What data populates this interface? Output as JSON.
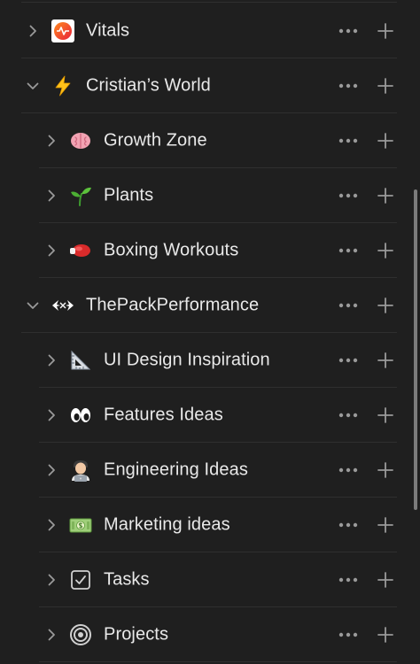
{
  "sidebar": {
    "items": [
      {
        "label": "Vitals",
        "icon": "vitals-logo-icon",
        "expanded": false,
        "depth": 0
      },
      {
        "label": "Cristian’s World",
        "icon": "lightning-icon",
        "expanded": true,
        "depth": 0
      },
      {
        "label": "Growth Zone",
        "icon": "brain-icon",
        "expanded": false,
        "depth": 1
      },
      {
        "label": "Plants",
        "icon": "seedling-icon",
        "expanded": false,
        "depth": 1
      },
      {
        "label": "Boxing Workouts",
        "icon": "boxing-glove-icon",
        "expanded": false,
        "depth": 1
      },
      {
        "label": "ThePackPerformance",
        "icon": "pack-logo-icon",
        "expanded": true,
        "depth": 0
      },
      {
        "label": "UI Design Inspiration",
        "icon": "triangular-ruler-icon",
        "expanded": false,
        "depth": 1
      },
      {
        "label": "Features Ideas",
        "icon": "eyes-icon",
        "expanded": false,
        "depth": 1
      },
      {
        "label": "Engineering Ideas",
        "icon": "technologist-icon",
        "expanded": false,
        "depth": 1
      },
      {
        "label": "Marketing ideas",
        "icon": "dollar-banknote-icon",
        "expanded": false,
        "depth": 1
      },
      {
        "label": "Tasks",
        "icon": "checkbox-icon",
        "expanded": false,
        "depth": 1
      },
      {
        "label": "Projects",
        "icon": "target-icon",
        "expanded": false,
        "depth": 1
      }
    ]
  },
  "colors": {
    "background": "#1f1f1f",
    "divider": "#2f2f2f",
    "text": "#e9e9e9",
    "icon_muted": "#9a9a9a",
    "scrollbar": "#7b7b7b"
  }
}
